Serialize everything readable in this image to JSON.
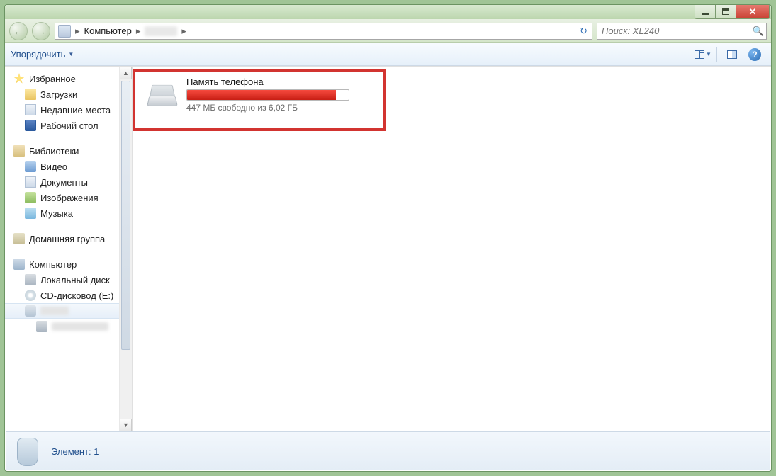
{
  "breadcrumb": {
    "root": "Компьютер"
  },
  "search": {
    "placeholder": "Поиск: XL240"
  },
  "toolbar": {
    "organize": "Упорядочить"
  },
  "sidebar": {
    "favorites": {
      "label": "Избранное",
      "items": [
        "Загрузки",
        "Недавние места",
        "Рабочий стол"
      ]
    },
    "libraries": {
      "label": "Библиотеки",
      "items": [
        "Видео",
        "Документы",
        "Изображения",
        "Музыка"
      ]
    },
    "homegroup": {
      "label": "Домашняя группа"
    },
    "computer": {
      "label": "Компьютер",
      "items": [
        "Локальный диск",
        "CD-дисковод (E:)"
      ]
    }
  },
  "drive": {
    "name": "Память телефона",
    "free_text": "447 МБ свободно из 6,02 ГБ",
    "fill_percent": 92
  },
  "status": {
    "text": "Элемент: 1"
  }
}
